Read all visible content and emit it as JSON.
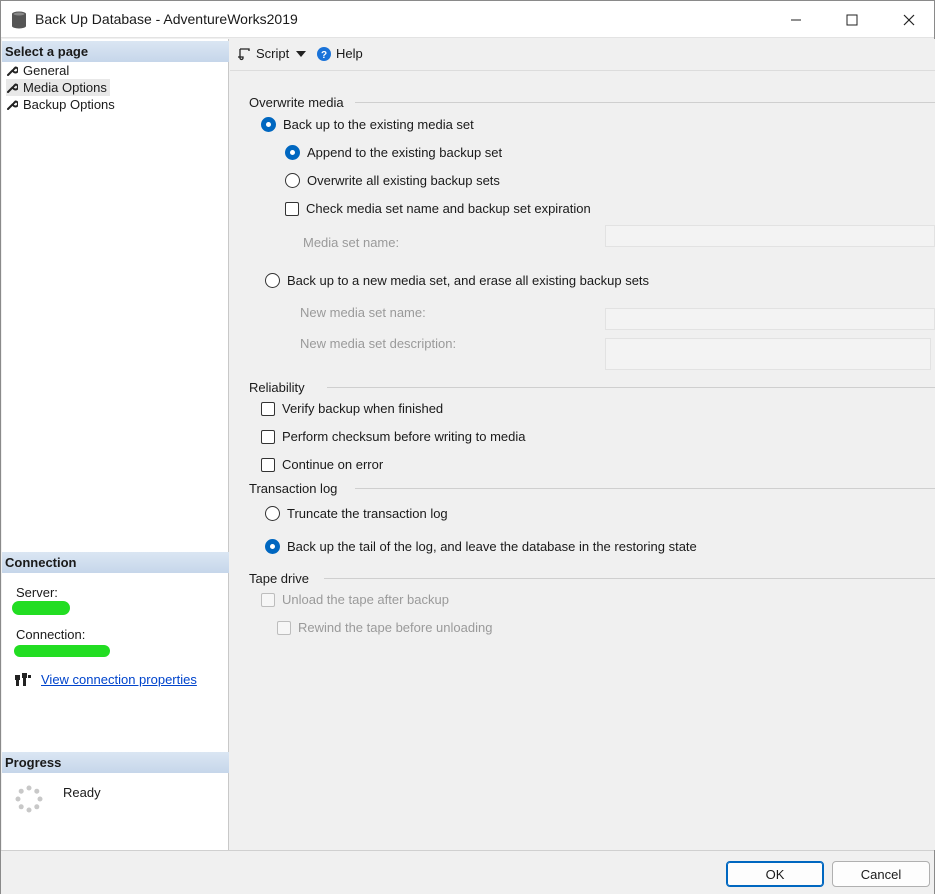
{
  "window": {
    "title": "Back Up Database - AdventureWorks2019"
  },
  "sidebar": {
    "header": "Select a page",
    "items": [
      {
        "label": "General",
        "selected": false
      },
      {
        "label": "Media Options",
        "selected": true
      },
      {
        "label": "Backup Options",
        "selected": false
      }
    ]
  },
  "connection": {
    "header": "Connection",
    "server_label": "Server:",
    "connection_label": "Connection:",
    "link": "View connection properties"
  },
  "progress": {
    "header": "Progress",
    "status": "Ready"
  },
  "toolbar": {
    "script_label": "Script",
    "help_label": "Help"
  },
  "overwrite_media": {
    "title": "Overwrite media",
    "existing_set": "Back up to the existing media set",
    "append": "Append to the existing backup set",
    "overwrite_all": "Overwrite all existing backup sets",
    "check_media": "Check media set name and backup set expiration",
    "media_set_name_label": "Media set name:",
    "new_set": "Back up to a new media set, and erase all existing backup sets",
    "new_media_set_name_label": "New media set name:",
    "new_media_set_desc_label": "New media set description:"
  },
  "reliability": {
    "title": "Reliability",
    "verify": "Verify backup when finished",
    "checksum": "Perform checksum before writing to media",
    "continue_on_error": "Continue on error"
  },
  "transaction_log": {
    "title": "Transaction log",
    "truncate": "Truncate the transaction log",
    "tail": "Back up the tail of the log, and leave the database in the restoring state"
  },
  "tape_drive": {
    "title": "Tape drive",
    "unload": "Unload the tape after backup",
    "rewind": "Rewind the tape before unloading"
  },
  "buttons": {
    "ok": "OK",
    "cancel": "Cancel"
  },
  "colors": {
    "accent": "#0067c0",
    "link": "#0044cc",
    "redaction": "#22dd22"
  }
}
